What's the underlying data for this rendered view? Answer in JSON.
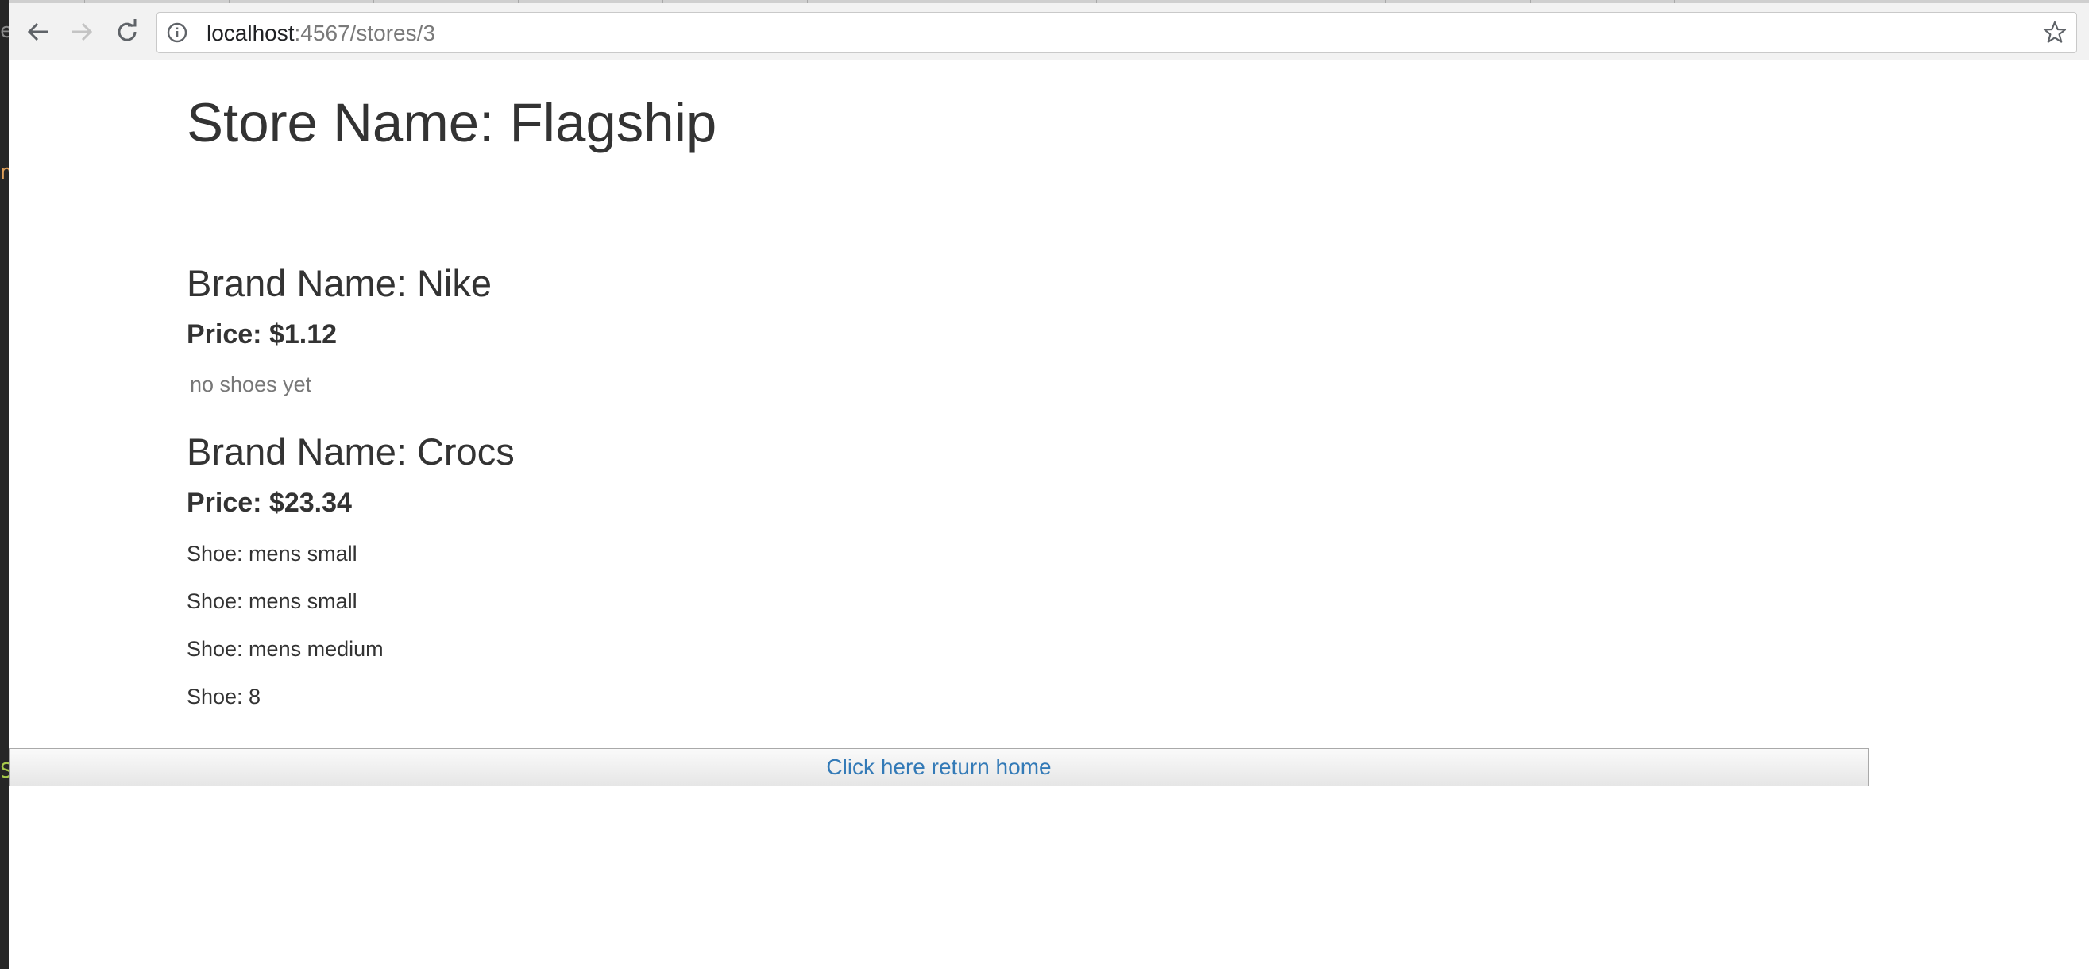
{
  "browser": {
    "url_host": "localhost",
    "url_path": ":4567/stores/3"
  },
  "editor_strip": {
    "chars": [
      {
        "char": "e",
        "color": "#8a8a8a"
      },
      {
        "char": "n",
        "color": "#e0a05a"
      },
      {
        "char": "S",
        "color": "#a6c94a"
      }
    ]
  },
  "store": {
    "title": "Store Name: Flagship"
  },
  "brands": [
    {
      "name": "Brand Name: Nike",
      "price": "Price: $1.12",
      "empty_message": "no shoes yet",
      "shoes": []
    },
    {
      "name": "Brand Name: Crocs",
      "price": "Price: $23.34",
      "shoes": [
        "Shoe: mens small",
        "Shoe: mens small",
        "Shoe: mens medium",
        "Shoe: 8"
      ]
    }
  ],
  "home_link": {
    "label": "Click here return home"
  },
  "colors": {
    "text": "#333333",
    "muted": "#777777",
    "link": "#337ab7"
  }
}
